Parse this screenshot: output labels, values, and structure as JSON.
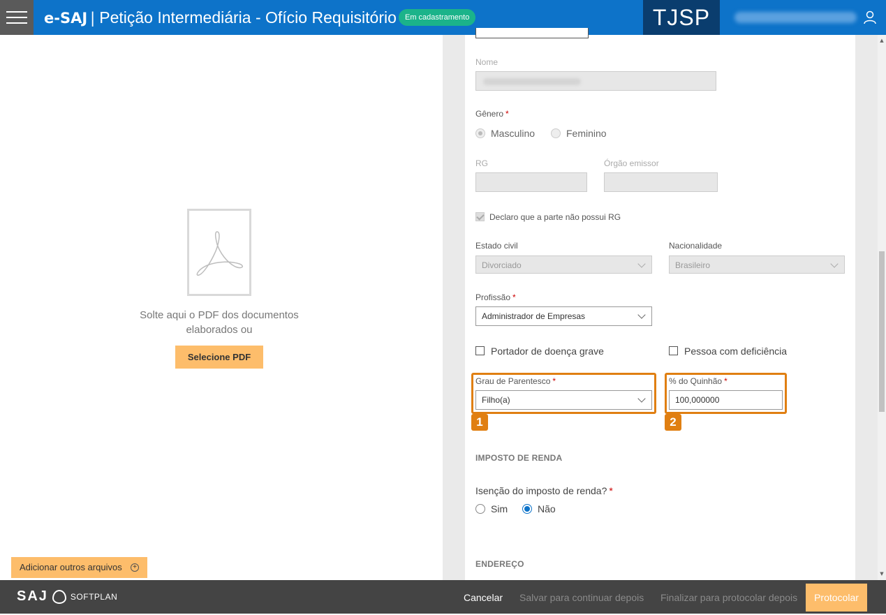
{
  "header": {
    "app_name": "e-SAJ",
    "separator": "|",
    "page_title": "Petição Intermediária - Ofício Requisitório",
    "status_badge": "Em cadastramento",
    "court": "TJSP"
  },
  "left_panel": {
    "drop_text": "Solte aqui o PDF dos documentos elaborados ou",
    "select_pdf_label": "Selecione PDF",
    "add_files_label": "Adicionar outros arquivos",
    "add_files_icon": "⊕"
  },
  "form": {
    "nome_label": "Nome",
    "genero_label": "Gênero",
    "genero_options": [
      "Masculino",
      "Feminino"
    ],
    "genero_selected": "Masculino",
    "rg_label": "RG",
    "orgao_label": "Órgão emissor",
    "declaro_label": "Declaro que a parte não possui RG",
    "declaro_checked": true,
    "estado_civil_label": "Estado civil",
    "estado_civil_value": "Divorciado",
    "nacionalidade_label": "Nacionalidade",
    "nacionalidade_value": "Brasileiro",
    "profissao_label": "Profissão",
    "profissao_value": "Administrador de Empresas",
    "doenca_label": "Portador de doença grave",
    "deficiencia_label": "Pessoa com deficiência",
    "grau_label": "Grau de Parentesco",
    "grau_value": "Filho(a)",
    "quinhao_label": "% do Quinhão",
    "quinhao_value": "100,000000",
    "required_mark": "*",
    "badge_1": "1",
    "badge_2": "2",
    "imposto_section": "IMPOSTO DE RENDA",
    "isencao_label": "Isenção do imposto de renda?",
    "isencao_options": [
      "Sim",
      "Não"
    ],
    "isencao_selected": "Não",
    "endereco_section": "ENDEREÇO"
  },
  "footer": {
    "brand": "SAJ",
    "softplan": "SOFTPLAN",
    "cancel": "Cancelar",
    "save_later": "Salvar para continuar depois",
    "finish_later": "Finalizar para protocolar depois",
    "protocolar": "Protocolar"
  },
  "colors": {
    "header_blue": "#0d73c9",
    "tjsp_navy": "#0a3d6e",
    "status_green": "#1bb38a",
    "accent_orange": "#fdbd6b",
    "highlight_orange": "#e07f12",
    "footer_gray": "#444444"
  }
}
